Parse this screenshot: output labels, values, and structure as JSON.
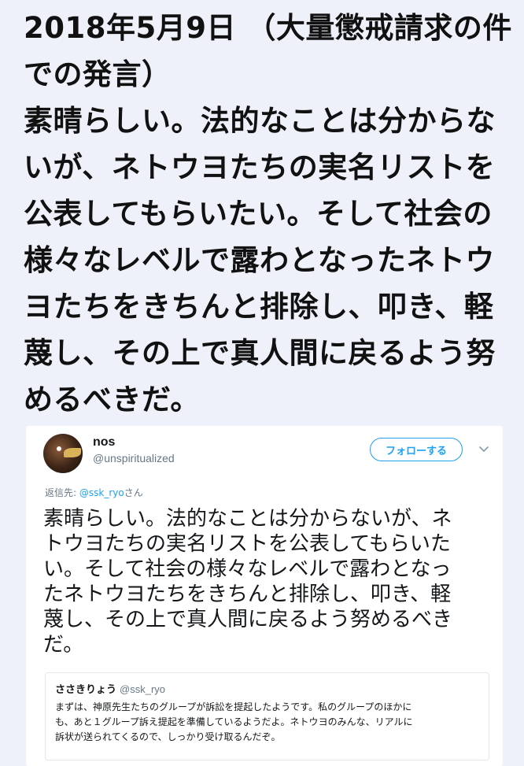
{
  "caption": {
    "lines": [
      "2018年5月9日 （大量懲戒請求の件",
      "での発言）",
      "素晴らしい。法的なことは分からな",
      "いが、ネトウヨたちの実名リストを",
      "公表してもらいたい。そして社会の",
      "様々なレベルで露わとなったネトウ",
      "ヨたちをきちんと排除し、叩き、軽",
      "蔑し、その上で真人間に戻るよう努",
      "めるべきだ。"
    ]
  },
  "tweet": {
    "author_name": "nos",
    "author_handle": "@unspiritualized",
    "follow_label": "フォローする",
    "reply_prefix": "返信先: ",
    "reply_mention": "@ssk_ryo",
    "reply_suffix": "さん",
    "text_lines": [
      "素晴らしい。法的なことは分からないが、ネ",
      "トウヨたちの実名リストを公表してもらいた",
      "い。そして社会の様々なレベルで露わとなっ",
      "たネトウヨたちをきちんと排除し、叩き、軽",
      "蔑し、その上で真人間に戻るよう努めるべき",
      "だ。"
    ],
    "quote": {
      "name": "ささきりょう",
      "handle": "@ssk_ryo",
      "text_lines": [
        "まずは、神原先生たちのグループが訴訟を提起したようです。私のグループのほかに",
        "も、あと１グループ訴え提起を準備しているようだよ。ネトウヨのみんな、リアルに",
        "訴状が送られてくるので、しっかり受け取るんだぞ。"
      ]
    }
  },
  "icons": {
    "avatar": "owl-avatar",
    "menu": "chevron-down-icon"
  },
  "colors": {
    "accent": "#1da1f2",
    "background": "#eef1f9"
  }
}
